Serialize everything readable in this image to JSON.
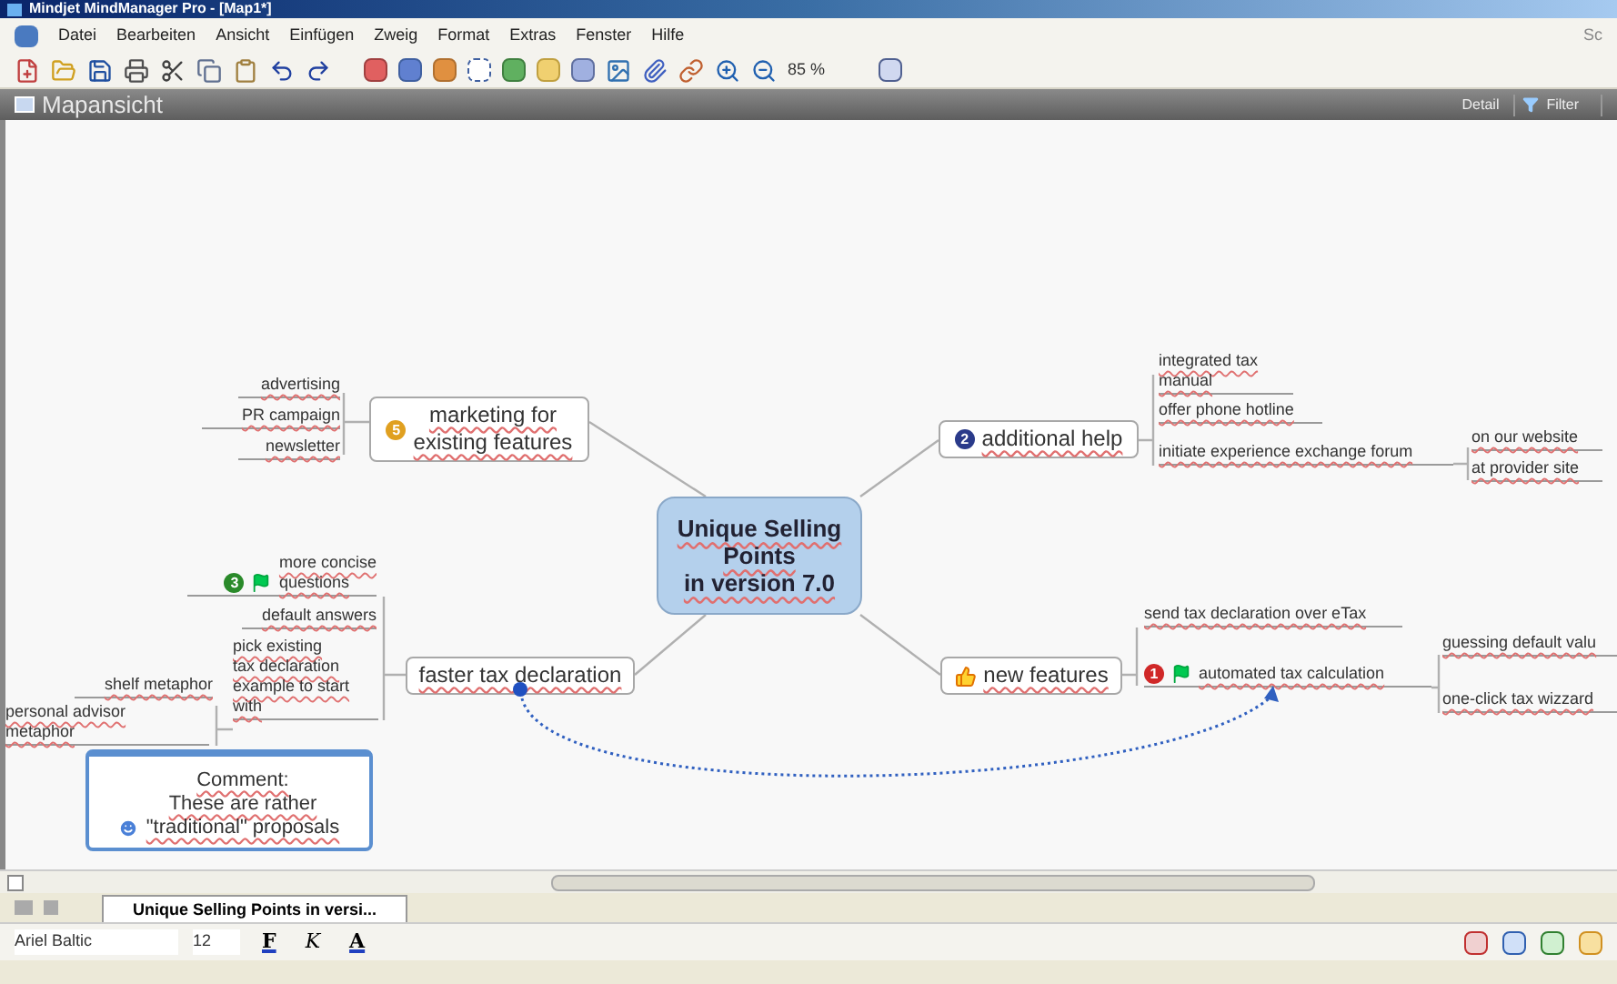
{
  "window": {
    "title": "Mindjet MindManager Pro - [Map1*]"
  },
  "menu": {
    "items": [
      "Datei",
      "Bearbeiten",
      "Ansicht",
      "Einfügen",
      "Zweig",
      "Format",
      "Extras",
      "Fenster",
      "Hilfe"
    ],
    "right_cut": "Sc"
  },
  "toolbar": {
    "zoom": "85 %"
  },
  "view_bar": {
    "title": "Mapansicht",
    "buttons": [
      "Detail",
      "Filter"
    ]
  },
  "map": {
    "central": {
      "text": "Unique Selling\nPoints\nin version 7.0"
    },
    "topics": [
      {
        "text": "marketing for\nexisting features",
        "badge": {
          "label": "5",
          "color": "#e0a020"
        },
        "children": [
          {
            "text": "advertising"
          },
          {
            "text": "PR campaign"
          },
          {
            "text": "newsletter"
          }
        ]
      },
      {
        "text": "additional help",
        "badge": {
          "label": "2",
          "color": "#2a3a8a"
        },
        "children": [
          {
            "text": "integrated tax\nmanual"
          },
          {
            "text": "offer phone hotline"
          },
          {
            "text": "initiate experience exchange forum",
            "children": [
              {
                "text": "on our website"
              },
              {
                "text": "at provider site"
              }
            ]
          }
        ]
      },
      {
        "text": "new features",
        "children": [
          {
            "text": "send tax declaration over eTax"
          },
          {
            "text": "automated tax calculation",
            "badge": {
              "label": "1",
              "color": "#d02828"
            },
            "flag": true,
            "children": [
              {
                "text": "guessing default valu"
              },
              {
                "text": "one-click tax wizzard"
              }
            ]
          }
        ]
      },
      {
        "text": "faster tax declaration",
        "children": [
          {
            "text": "more concise\nquestions",
            "badge": {
              "label": "3",
              "color": "#2a8a2a"
            },
            "flag": true
          },
          {
            "text": "default answers"
          },
          {
            "text": "pick existing\ntax declaration\nexample to start\nwith",
            "children": [
              {
                "text": "shelf metaphor"
              },
              {
                "text": "personal advisor\nmetaphor"
              }
            ]
          }
        ]
      }
    ],
    "comment": {
      "text": "Comment:\nThese are rather\n\"traditional\" proposals"
    }
  },
  "tabs": [
    {
      "label": "Unique Selling Points in versi...",
      "selected": true
    }
  ],
  "format_bar": {
    "font": "Ariel Baltic",
    "size": "12",
    "buttons": [
      "F",
      "K",
      "A"
    ]
  }
}
